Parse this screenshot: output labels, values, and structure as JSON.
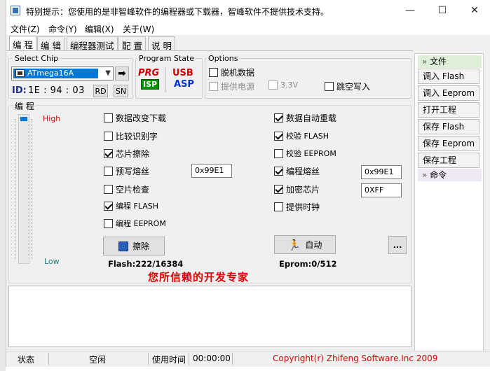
{
  "window": {
    "title": "特别提示：您使用的是非智峰软件的编程器或下载器，智峰软件不提供技术支持。",
    "minimize_glyph": "—",
    "maximize_glyph": "☐",
    "close_glyph": "✕"
  },
  "menu": [
    "文件(Z)",
    "命令(Y)",
    "编辑(X)",
    "关于(W)"
  ],
  "tabs": [
    "编 程",
    "编 辑",
    "编程器测试",
    "配 置",
    "说 明"
  ],
  "select_chip": {
    "label": "Select Chip",
    "value": "ATmega16A",
    "id_label": "ID:",
    "id_value": "1E : 94 : 03",
    "rd_label": "RD",
    "sn_label": "SN"
  },
  "program_state": {
    "label": "Program State",
    "prg": "PRG",
    "isp": "ISP",
    "usb": "USB",
    "asp": "ASP"
  },
  "options": {
    "label": "Options",
    "offline": "脱机数据",
    "power": "提供电源",
    "voltage": "3.3V",
    "jump_write": "跳空写入"
  },
  "program_group": {
    "label": "编 程",
    "high": "High",
    "low": "Low"
  },
  "checks_left": [
    {
      "label": "数据改变下载",
      "checked": false
    },
    {
      "label": "比较识别字",
      "checked": false
    },
    {
      "label": "芯片擦除",
      "checked": true
    },
    {
      "label": "预写熔丝",
      "checked": false
    },
    {
      "label": "空片检查",
      "checked": false
    },
    {
      "label": "编程 FLASH",
      "checked": true
    },
    {
      "label": "编程 EEPROM",
      "checked": false
    }
  ],
  "checks_right": [
    {
      "label": "数据自动重载",
      "checked": true
    },
    {
      "label": "校验 FLASH",
      "checked": true
    },
    {
      "label": "校验 EEPROM",
      "checked": false
    },
    {
      "label": "编程熔丝",
      "checked": true
    },
    {
      "label": "加密芯片",
      "checked": true
    },
    {
      "label": "提供时钟",
      "checked": false
    }
  ],
  "fields": {
    "prewrite_fuse": "0x99E1",
    "program_fuse": "0x99E1",
    "lock": "0XFF"
  },
  "buttons": {
    "erase": "擦除",
    "auto": "自动",
    "more": "..."
  },
  "flash_info": "Flash:222/16384",
  "eeprom_info": "Eprom:0/512",
  "slogan": "您所信赖的开发专家",
  "sidebar": {
    "file_header": "文件",
    "items": [
      "调入 Flash",
      "调入 Eeprom",
      "打开工程",
      "保存 Flash",
      "保存 Eeprom",
      "保存工程"
    ],
    "cmd_header": "命令"
  },
  "status": {
    "state_label": "状态",
    "state_value": "空闲",
    "time_label": "使用时间",
    "time_value": "00:00:00",
    "copyright": "Copyright(r) Zhifeng Software.Inc 2009"
  },
  "colors": {
    "slogan": "#e00000",
    "copyright": "#e00000",
    "high": "#d00000",
    "low": "#1a7a7a",
    "selection": "#0078d7",
    "prg": "#d00000",
    "isp": "#009000",
    "usb": "#d00000",
    "asp": "#0033cc"
  }
}
